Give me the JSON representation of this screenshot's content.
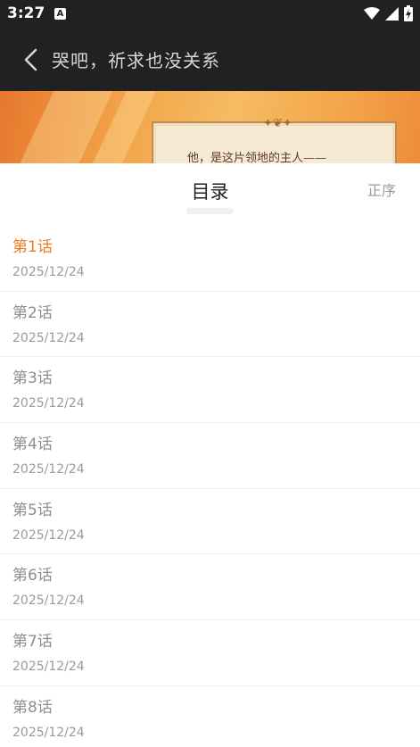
{
  "status_bar": {
    "time": "3:27",
    "notification_badge": "A",
    "icons": [
      "wifi-icon",
      "signal-icon",
      "battery-charging-icon"
    ]
  },
  "app_bar": {
    "back_icon": "chevron-left-icon",
    "title": "哭吧，祈求也没关系"
  },
  "banner": {
    "text": "他，是这片领地的主人——"
  },
  "toc": {
    "title": "目录",
    "sort_label": "正序",
    "chapters": [
      {
        "name": "第1话",
        "date": "2025/12/24",
        "active": true
      },
      {
        "name": "第2话",
        "date": "2025/12/24"
      },
      {
        "name": "第3话",
        "date": "2025/12/24"
      },
      {
        "name": "第4话",
        "date": "2025/12/24"
      },
      {
        "name": "第5话",
        "date": "2025/12/24"
      },
      {
        "name": "第6话",
        "date": "2025/12/24"
      },
      {
        "name": "第7话",
        "date": "2025/12/24"
      },
      {
        "name": "第8话",
        "date": "2025/12/24"
      }
    ]
  },
  "colors": {
    "bar_background": "#212121",
    "active_chapter": "#ed7b22",
    "inactive_text": "#8e8e8e"
  }
}
